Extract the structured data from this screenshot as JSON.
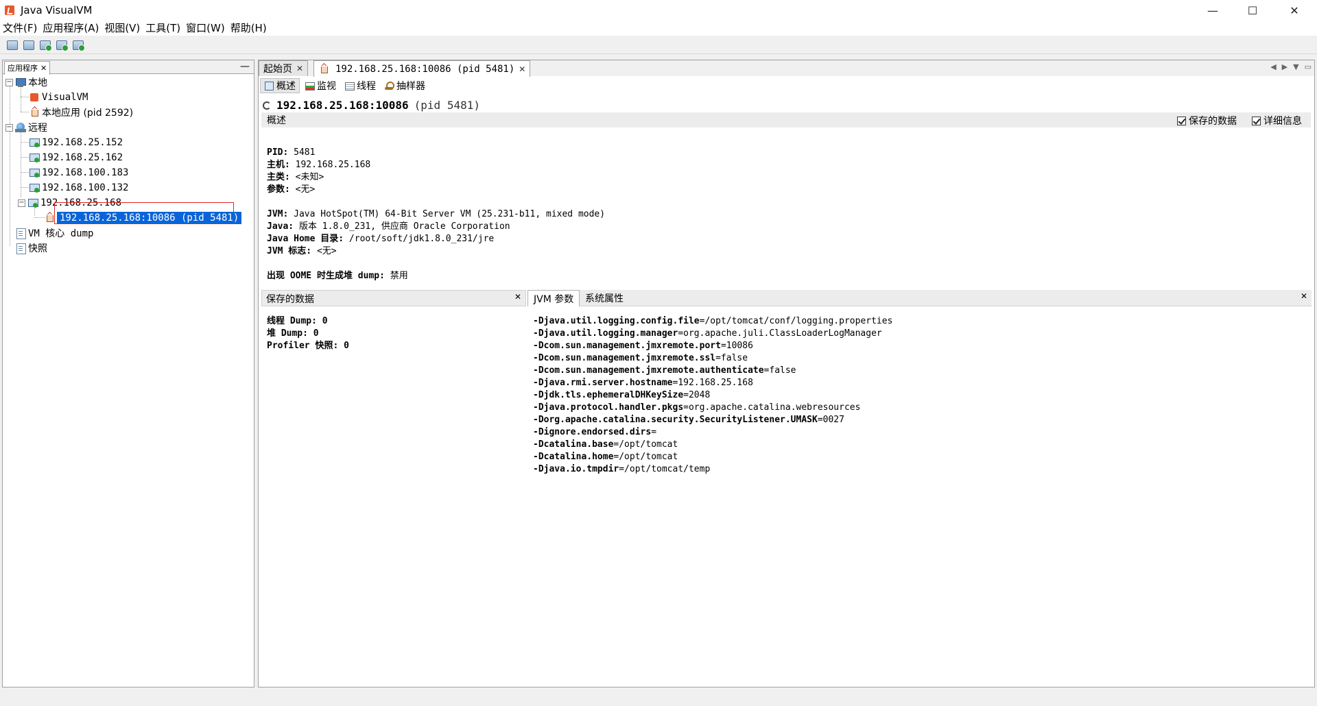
{
  "window": {
    "title": "Java VisualVM",
    "controls": {
      "minimize": "—",
      "maximize": "☐",
      "close": "✕"
    }
  },
  "menu": [
    "文件(F)",
    "应用程序(A)",
    "视图(V)",
    "工具(T)",
    "窗口(W)",
    "帮助(H)"
  ],
  "toolbar": {
    "buttons": [
      {
        "icon": "open-snapshot-icon"
      },
      {
        "icon": "save-icon"
      },
      {
        "icon": "add-remote-host-icon"
      },
      {
        "icon": "add-jmx-connection-icon"
      },
      {
        "icon": "add-snapshot-icon"
      }
    ]
  },
  "left_panel": {
    "tab_label": "应用程序",
    "tab_close": "✕",
    "minimize": "—",
    "tree": {
      "local": "本地",
      "visualvm": "VisualVM",
      "local_app": "本地应用 (pid 2592)",
      "remote": "远程",
      "hosts": [
        "192.168.25.152",
        "192.168.25.162",
        "192.168.100.183",
        "192.168.100.132",
        "192.168.25.168"
      ],
      "jmx_app": "192.168.25.168:10086 (pid 5481)",
      "vm_core_dump": "VM 核心 dump",
      "snapshots": "快照"
    }
  },
  "doc_tabs": {
    "start": "起始页",
    "app": "192.168.25.168:10086 (pid 5481)",
    "close": "✕"
  },
  "subtabs": [
    "概述",
    "监视",
    "线程",
    "抽样器"
  ],
  "heading": {
    "address": "192.168.25.168:10086",
    "pid": "(pid 5481)"
  },
  "overview": {
    "label": "概述",
    "checkbox_saved": "保存的数据",
    "checkbox_details": "详细信息",
    "info": [
      {
        "key": "PID:",
        "value": " 5481"
      },
      {
        "key": "主机:",
        "value": " 192.168.25.168"
      },
      {
        "key": "主类:",
        "value": " <未知>"
      },
      {
        "key": "参数:",
        "value": " <无>"
      },
      {
        "key": "",
        "value": ""
      },
      {
        "key": "JVM:",
        "value": " Java HotSpot(TM) 64-Bit Server VM (25.231-b11, mixed mode)"
      },
      {
        "key": "Java:",
        "value": " 版本 1.8.0_231, 供应商 Oracle Corporation"
      },
      {
        "key": "Java Home 目录:",
        "value": " /root/soft/jdk1.8.0_231/jre"
      },
      {
        "key": "JVM 标志:",
        "value": " <无>"
      },
      {
        "key": "",
        "value": ""
      },
      {
        "key": "出现 OOME 时生成堆 dump:",
        "value": " 禁用"
      }
    ]
  },
  "saved_data": {
    "title": "保存的数据",
    "close": "✕",
    "lines": [
      "线程 Dump: 0",
      "堆 Dump: 0",
      "Profiler 快照: 0"
    ]
  },
  "jvm_args": {
    "tab_active": "JVM 参数",
    "tab_other": "系统属性",
    "close": "✕",
    "args": [
      {
        "key": "-Djava.util.logging.config.file",
        "value": "=/opt/tomcat/conf/logging.properties"
      },
      {
        "key": "-Djava.util.logging.manager",
        "value": "=org.apache.juli.ClassLoaderLogManager"
      },
      {
        "key": "-Dcom.sun.management.jmxremote.port",
        "value": "=10086"
      },
      {
        "key": "-Dcom.sun.management.jmxremote.ssl",
        "value": "=false"
      },
      {
        "key": "-Dcom.sun.management.jmxremote.authenticate",
        "value": "=false"
      },
      {
        "key": "-Djava.rmi.server.hostname",
        "value": "=192.168.25.168"
      },
      {
        "key": "-Djdk.tls.ephemeralDHKeySize",
        "value": "=2048"
      },
      {
        "key": "-Djava.protocol.handler.pkgs",
        "value": "=org.apache.catalina.webresources"
      },
      {
        "key": "-Dorg.apache.catalina.security.SecurityListener.UMASK",
        "value": "=0027"
      },
      {
        "key": "-Dignore.endorsed.dirs",
        "value": "="
      },
      {
        "key": "-Dcatalina.base",
        "value": "=/opt/tomcat"
      },
      {
        "key": "-Dcatalina.home",
        "value": "=/opt/tomcat"
      },
      {
        "key": "-Djava.io.tmpdir",
        "value": "=/opt/tomcat/temp"
      }
    ]
  },
  "colors": {
    "selection": "#0a64d8",
    "highlight_box": "#e02020"
  }
}
